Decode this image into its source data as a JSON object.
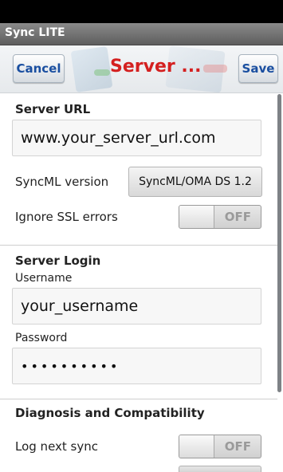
{
  "app": {
    "title": "Sync LITE"
  },
  "header": {
    "cancel_label": "Cancel",
    "title": "Server ...",
    "save_label": "Save"
  },
  "server": {
    "section_title": "Server URL",
    "url_value": "www.your_server_url.com",
    "syncml_label": "SyncML version",
    "syncml_value": "SyncML/OMA DS 1.2",
    "ignore_ssl_label": "Ignore SSL errors",
    "ignore_ssl_state": "OFF"
  },
  "login": {
    "section_title": "Server Login",
    "username_label": "Username",
    "username_value": "your_username",
    "password_label": "Password",
    "password_value": "••••••••••"
  },
  "diagnosis": {
    "section_title": "Diagnosis and Compatibility",
    "log_label": "Log next sync",
    "log_state": "OFF"
  },
  "colors": {
    "title_red": "#d42020",
    "button_blue": "#1a4fa0"
  }
}
